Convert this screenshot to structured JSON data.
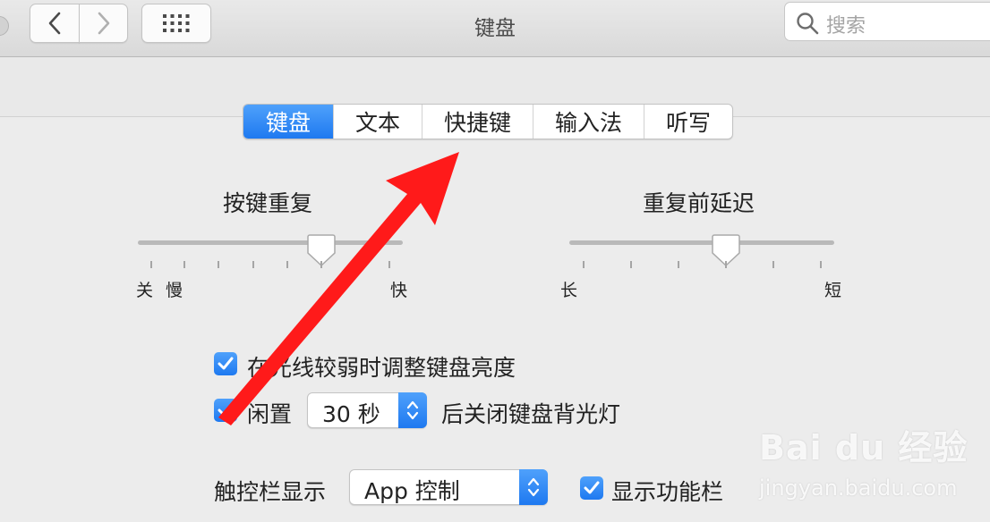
{
  "window": {
    "title": "键盘"
  },
  "toolbar": {
    "back_icon": "chevron-left-icon",
    "forward_icon": "chevron-right-icon",
    "grid_icon": "grid-icon"
  },
  "search": {
    "placeholder": "搜索",
    "icon": "search-icon"
  },
  "tabs": [
    {
      "label": "键盘",
      "active": true
    },
    {
      "label": "文本",
      "active": false
    },
    {
      "label": "快捷键",
      "active": false
    },
    {
      "label": "输入法",
      "active": false
    },
    {
      "label": "听写",
      "active": false
    }
  ],
  "key_repeat": {
    "title": "按键重复",
    "labels": [
      "关",
      "慢",
      "快"
    ],
    "position_fraction": 0.69
  },
  "delay_until_repeat": {
    "title": "重复前延迟",
    "labels": [
      "长",
      "短"
    ],
    "position_fraction": 0.59
  },
  "options": {
    "adjust_brightness": {
      "label": "在光线较弱时调整键盘亮度",
      "checked": true
    },
    "idle_off": {
      "prefix": "闲置",
      "value": "30 秒",
      "suffix": "后关闭键盘背光灯",
      "checked": true
    }
  },
  "touch_bar": {
    "label": "触控栏显示",
    "value": "App 控制",
    "show_fn_label": "显示功能栏",
    "show_fn_checked": true
  },
  "watermark": {
    "brand": "Bai du 经验",
    "url": "jingyan.baidu.com"
  },
  "colors": {
    "accent": "#1e79f0",
    "annotation_arrow": "#ff1a1a"
  }
}
